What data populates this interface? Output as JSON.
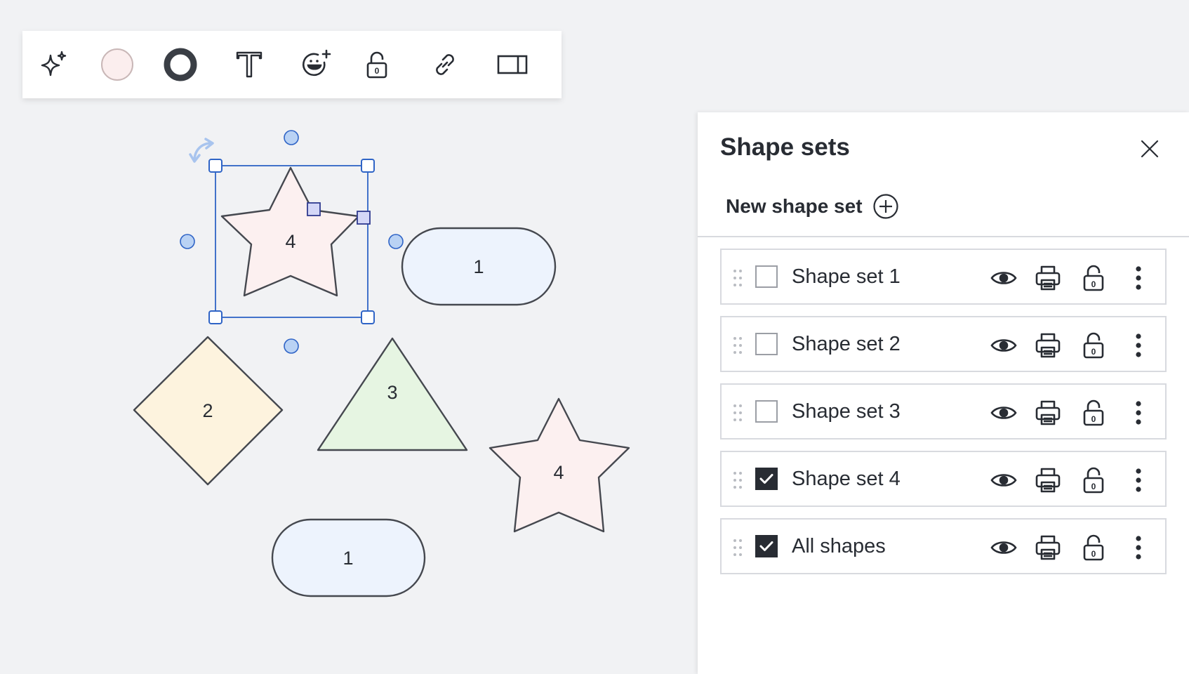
{
  "toolbar": {
    "items": [
      {
        "name": "ai-sparkle-icon"
      },
      {
        "name": "fill-color-swatch",
        "color": "#fbeeee"
      },
      {
        "name": "border-style-button",
        "color": "#3a3e45"
      },
      {
        "name": "text-icon"
      },
      {
        "name": "add-emoji-icon"
      },
      {
        "name": "lock-icon"
      },
      {
        "name": "link-icon"
      },
      {
        "name": "panel-toggle-icon"
      }
    ]
  },
  "canvas": {
    "shapes": [
      {
        "type": "star",
        "label": "4",
        "fill": "#fcf0f0",
        "selected": true
      },
      {
        "type": "terminator",
        "label": "1",
        "fill": "#edf3fd"
      },
      {
        "type": "diamond",
        "label": "2",
        "fill": "#fdf3de"
      },
      {
        "type": "triangle",
        "label": "3",
        "fill": "#e6f5e2"
      },
      {
        "type": "star",
        "label": "4",
        "fill": "#fcf0f0"
      },
      {
        "type": "terminator",
        "label": "1",
        "fill": "#edf3fd"
      }
    ],
    "selection_color": "#2f64c6",
    "handle_fill": "#b9d2f4"
  },
  "panel": {
    "title": "Shape sets",
    "new_set_label": "New shape set",
    "rows": [
      {
        "label": "Shape set 1",
        "checked": false
      },
      {
        "label": "Shape set 2",
        "checked": false
      },
      {
        "label": "Shape set 3",
        "checked": false
      },
      {
        "label": "Shape set 4",
        "checked": true
      },
      {
        "label": "All shapes",
        "checked": true
      }
    ],
    "row_icons": [
      "eye-icon",
      "print-icon",
      "unlock-icon",
      "more-vertical-icon"
    ]
  }
}
